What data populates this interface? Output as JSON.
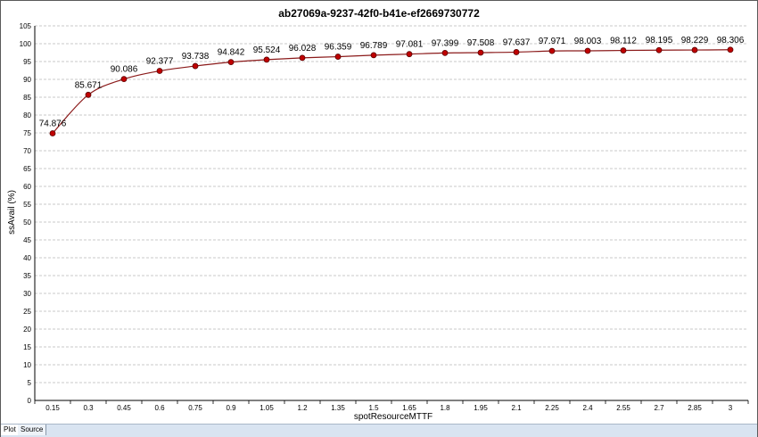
{
  "tabs": [
    {
      "label": "Plot",
      "active": true
    },
    {
      "label": "Source",
      "active": false
    }
  ],
  "colors": {
    "line": "#8b1a1a",
    "marker_fill": "#c00000",
    "grid": "#b8b8b8"
  },
  "chart_data": {
    "type": "line",
    "title": "ab27069a-9237-42f0-b41e-ef2669730772",
    "xlabel": "spotResourceMTTF",
    "ylabel": "ssAvail (%)",
    "ylim": [
      0,
      105
    ],
    "yticks": [
      0,
      5,
      10,
      15,
      20,
      25,
      30,
      35,
      40,
      45,
      50,
      55,
      60,
      65,
      70,
      75,
      80,
      85,
      90,
      95,
      100,
      105
    ],
    "grid": "horizontal-dashed",
    "categories": [
      "0.15",
      "0.3",
      "0.45",
      "0.6",
      "0.75",
      "0.9",
      "1.05",
      "1.2",
      "1.35",
      "1.5",
      "1.65",
      "1.8",
      "1.95",
      "2.1",
      "2.25",
      "2.4",
      "2.55",
      "2.7",
      "2.85",
      "3"
    ],
    "values": [
      74.876,
      85.671,
      90.086,
      92.377,
      93.738,
      94.842,
      95.524,
      96.028,
      96.359,
      96.789,
      97.081,
      97.399,
      97.508,
      97.637,
      97.971,
      98.003,
      98.112,
      98.195,
      98.229,
      98.306
    ],
    "value_labels": [
      "74.876",
      "85.671",
      "90.086",
      "92.377",
      "93.738",
      "94.842",
      "95.524",
      "96.028",
      "96.359",
      "96.789",
      "97.081",
      "97.399",
      "97.508",
      "97.637",
      "97.971",
      "98.003",
      "98.112",
      "98.195",
      "98.229",
      "98.306"
    ]
  }
}
